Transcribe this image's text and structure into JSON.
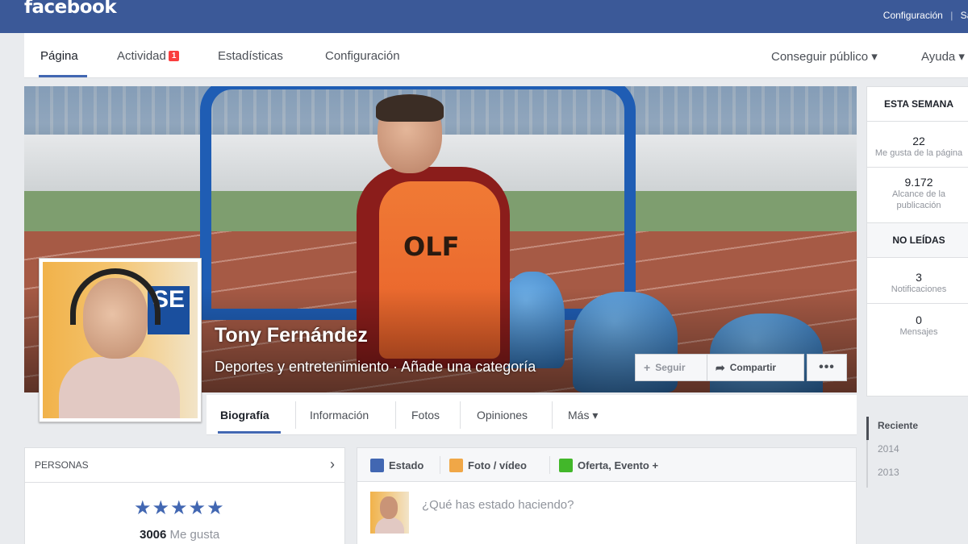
{
  "topbar": {
    "logo": "facebook",
    "links": [
      "Configuración",
      "Sal"
    ]
  },
  "admin_nav": {
    "items": [
      {
        "label": "Página",
        "active": true
      },
      {
        "label": "Actividad",
        "badge": "1"
      },
      {
        "label": "Estadísticas"
      },
      {
        "label": "Configuración"
      }
    ],
    "right": [
      {
        "label": "Conseguir público ▾"
      },
      {
        "label": "Ayuda ▾"
      }
    ]
  },
  "cover": {
    "page_name": "Tony Fernández",
    "category": "Deportes y entretenimiento · Añade una categoría",
    "vest_text": "OLF",
    "follow_label": "Seguir",
    "share_label": "Compartir",
    "more_label": "•••"
  },
  "profile_pic": {
    "sign_text": "SE"
  },
  "timeline_tabs": [
    {
      "label": "Biografía",
      "active": true
    },
    {
      "label": "Información"
    },
    {
      "label": "Fotos"
    },
    {
      "label": "Opiniones"
    },
    {
      "label": "Más ▾"
    }
  ],
  "right_sidebar": {
    "this_week_heading": "ESTA SEMANA",
    "stats": [
      {
        "value": "22",
        "label": "Me gusta de la página"
      },
      {
        "value": "9.172",
        "label": "Alcance de la publicación"
      }
    ],
    "unread_heading": "NO LEÍDAS",
    "unread": [
      {
        "value": "3",
        "label": "Notificaciones"
      },
      {
        "value": "0",
        "label": "Mensajes"
      }
    ]
  },
  "recent": {
    "items": [
      "Reciente",
      "2014",
      "2013"
    ]
  },
  "personas": {
    "heading": "PERSONAS",
    "stars": "★★★★★",
    "rating_count": "3006",
    "rating_label": "Me gusta"
  },
  "composer": {
    "tabs": [
      "Estado",
      "Foto / vídeo",
      "Oferta, Evento +"
    ],
    "placeholder": "¿Qué has estado haciendo?"
  },
  "colors": {
    "brand": "#3b5998",
    "accent": "#4267b2",
    "badge": "#fa3e3e"
  }
}
